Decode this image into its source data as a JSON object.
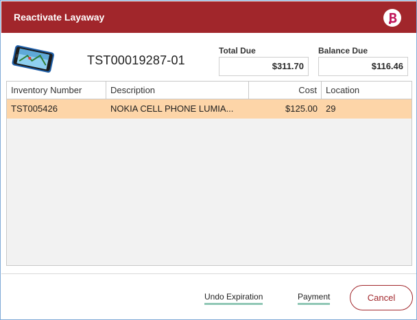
{
  "dialog": {
    "title": "Reactivate Layaway"
  },
  "colors": {
    "brand": "#a1262b",
    "selected_row": "#fdd5a8",
    "link_underline": "#8fc7b5"
  },
  "header": {
    "ticket_number": "TST00019287-01",
    "total_due_label": "Total Due",
    "total_due_value": "$311.70",
    "balance_due_label": "Balance Due",
    "balance_due_value": "$116.46"
  },
  "table": {
    "columns": [
      "Inventory Number",
      "Description",
      "Cost",
      "Location"
    ],
    "rows": [
      {
        "inventory_number": "TST005426",
        "description": "NOKIA CELL PHONE LUMIA...",
        "cost": "$125.00",
        "location": "29"
      }
    ]
  },
  "footer": {
    "undo_expiration_label": "Undo Expiration",
    "payment_label": "Payment",
    "cancel_label": "Cancel"
  },
  "icons": {
    "brand": "brand-logo-icon",
    "item": "cell-phone-image"
  }
}
